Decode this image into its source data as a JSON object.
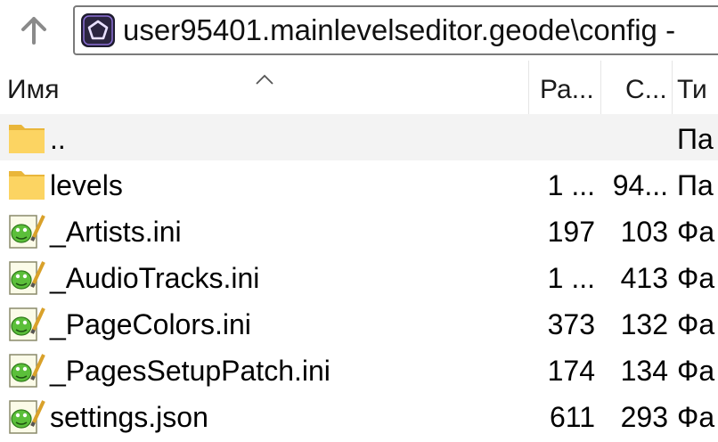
{
  "address": {
    "path": "user95401.mainlevelseditor.geode\\config - ",
    "app_icon": "pentagon-app-icon"
  },
  "columns": {
    "name": "Имя",
    "size": "Ра...",
    "compressed": "С...",
    "type": "Ти"
  },
  "files": [
    {
      "name": "..",
      "size": "",
      "compressed": "",
      "type": "Па",
      "icon": "folder-icon"
    },
    {
      "name": "levels",
      "size": "1 ...",
      "compressed": "94...",
      "type": "Па",
      "icon": "folder-icon"
    },
    {
      "name": "_Artists.ini",
      "size": "197",
      "compressed": "103",
      "type": "Фа",
      "icon": "notepad-file-icon"
    },
    {
      "name": "_AudioTracks.ini",
      "size": "1 ...",
      "compressed": "413",
      "type": "Фа",
      "icon": "notepad-file-icon"
    },
    {
      "name": "_PageColors.ini",
      "size": "373",
      "compressed": "132",
      "type": "Фа",
      "icon": "notepad-file-icon"
    },
    {
      "name": "_PagesSetupPatch.ini",
      "size": "174",
      "compressed": "134",
      "type": "Фа",
      "icon": "notepad-file-icon"
    },
    {
      "name": "settings.json",
      "size": "611",
      "compressed": "293",
      "type": "Фа",
      "icon": "notepad-file-icon"
    }
  ]
}
